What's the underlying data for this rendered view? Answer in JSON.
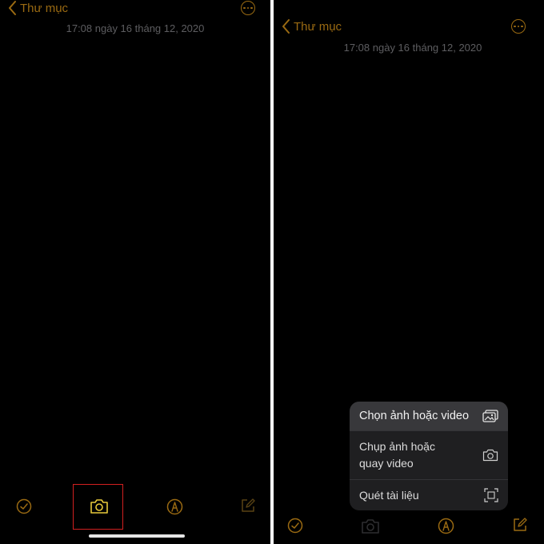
{
  "left": {
    "back_label": "Thư mục",
    "timestamp": "17:08 ngày 16 tháng 12, 2020"
  },
  "right": {
    "back_label": "Thư mục",
    "timestamp": "17:08 ngày 16 tháng 12, 2020",
    "menu": {
      "items": [
        {
          "label": "Chọn ảnh hoặc video",
          "icon": "photo-library-icon"
        },
        {
          "label": "Chụp ảnh hoặc\nquay video",
          "icon": "camera-icon"
        },
        {
          "label": "Quét tài liệu",
          "icon": "scan-document-icon"
        }
      ]
    }
  },
  "colors": {
    "accent": "#9a6a12",
    "camera_active": "#e7c93a",
    "highlight": "#d22020"
  }
}
